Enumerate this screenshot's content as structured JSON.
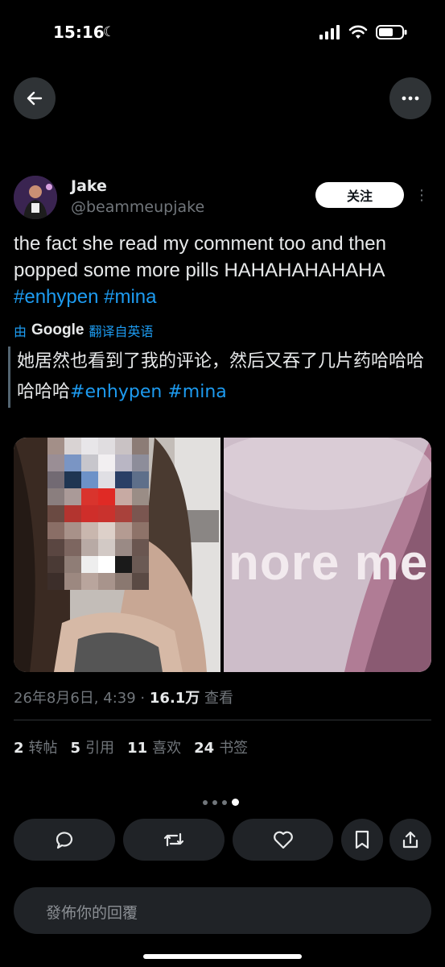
{
  "status_bar": {
    "time": "15:16",
    "icons": [
      "moon-icon",
      "cellular-signal-icon",
      "wifi-icon",
      "battery-icon"
    ]
  },
  "nav": {
    "back_icon": "arrow-left-icon",
    "more_icon": "ellipsis-icon"
  },
  "author": {
    "display_name": "Jake",
    "handle": "@beammeupjake",
    "follow_label": "关注"
  },
  "tweet": {
    "text": "the fact she read my comment too and then popped some more pills HAHAHAHAHAHA",
    "hashtags": [
      "#enhypen",
      "#mina"
    ]
  },
  "translation": {
    "prefix": "由",
    "provider": "Google",
    "suffix": "翻译自英语",
    "text": "她居然也看到了我的评论，然后又吞了几片药哈哈哈哈哈哈"
  },
  "media": {
    "right_caption": "nore me"
  },
  "meta": {
    "timestamp": "26年8月6日, 4:39",
    "separator": "·",
    "views": "16.1万",
    "views_label": "查看"
  },
  "stats": {
    "reposts_count": "2",
    "reposts_label": "转帖",
    "quotes_count": "5",
    "quotes_label": "引用",
    "likes_count": "11",
    "likes_label": "喜欢",
    "bookmarks_count": "24",
    "bookmarks_label": "书签"
  },
  "carousel": {
    "total": 4,
    "active": 4
  },
  "actions": [
    "reply-icon",
    "repost-icon",
    "like-icon",
    "bookmark-icon",
    "share-icon"
  ],
  "reply": {
    "placeholder": "發佈你的回覆"
  },
  "colors": {
    "background": "#000000",
    "link": "#1d9bf0",
    "muted": "#71767b",
    "button_bg": "#202327"
  }
}
